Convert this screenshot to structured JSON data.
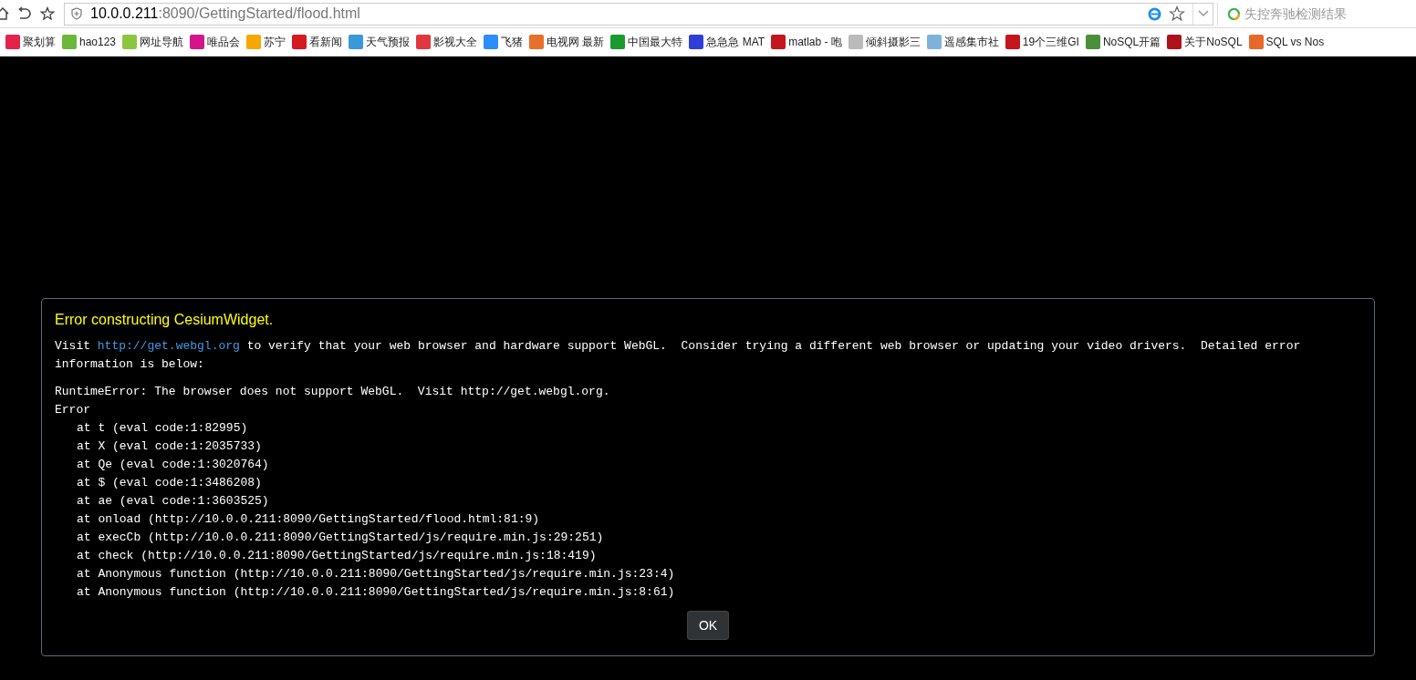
{
  "address_bar": {
    "host": "10.0.0.211",
    "path": ":8090/GettingStarted/flood.html"
  },
  "search": {
    "placeholder": "失控奔驰检测结果"
  },
  "bookmarks": [
    {
      "label": "聚划算",
      "color": "#e4234b"
    },
    {
      "label": "hao123",
      "color": "#6bb83a"
    },
    {
      "label": "网址导航",
      "color": "#8cc63f"
    },
    {
      "label": "唯品会",
      "color": "#d2168a"
    },
    {
      "label": "苏宁",
      "color": "#f6a800"
    },
    {
      "label": "看新闻",
      "color": "#d71920"
    },
    {
      "label": "天气预报",
      "color": "#3a9ad9"
    },
    {
      "label": "影视大全",
      "color": "#e0383e"
    },
    {
      "label": "飞猪",
      "color": "#2c8ef8"
    },
    {
      "label": "电视网 最新",
      "color": "#e8702a"
    },
    {
      "label": "中国最大特",
      "color": "#1a9b2e"
    },
    {
      "label": "急急急 MAT",
      "color": "#2f3fd6"
    },
    {
      "label": "matlab - 咆",
      "color": "#c4161c"
    },
    {
      "label": "倾斜摄影三",
      "color": "#bbbbbb"
    },
    {
      "label": "遥感集市社",
      "color": "#7fb2d9"
    },
    {
      "label": "19个三维GI",
      "color": "#c4161c"
    },
    {
      "label": "NoSQL开篇",
      "color": "#4a8f3c"
    },
    {
      "label": "关于NoSQL",
      "color": "#b0121b"
    },
    {
      "label": "SQL vs Nos",
      "color": "#e8682a"
    }
  ],
  "dialog": {
    "title": "Error constructing CesiumWidget.",
    "message": {
      "before": "Visit ",
      "link": "http://get.webgl.org",
      "after": " to verify that your web browser and hardware support WebGL.  Consider trying a different web browser or updating your video drivers.  Detailed error information is below:"
    },
    "error_lines": [
      "RuntimeError: The browser does not support WebGL.  Visit http://get.webgl.org.",
      "Error"
    ],
    "stack": [
      "at t (eval code:1:82995)",
      "at X (eval code:1:2035733)",
      "at Qe (eval code:1:3020764)",
      "at $ (eval code:1:3486208)",
      "at ae (eval code:1:3603525)",
      "at onload (http://10.0.0.211:8090/GettingStarted/flood.html:81:9)",
      "at execCb (http://10.0.0.211:8090/GettingStarted/js/require.min.js:29:251)",
      "at check (http://10.0.0.211:8090/GettingStarted/js/require.min.js:18:419)",
      "at Anonymous function (http://10.0.0.211:8090/GettingStarted/js/require.min.js:23:4)",
      "at Anonymous function (http://10.0.0.211:8090/GettingStarted/js/require.min.js:8:61)"
    ],
    "button": "OK"
  }
}
